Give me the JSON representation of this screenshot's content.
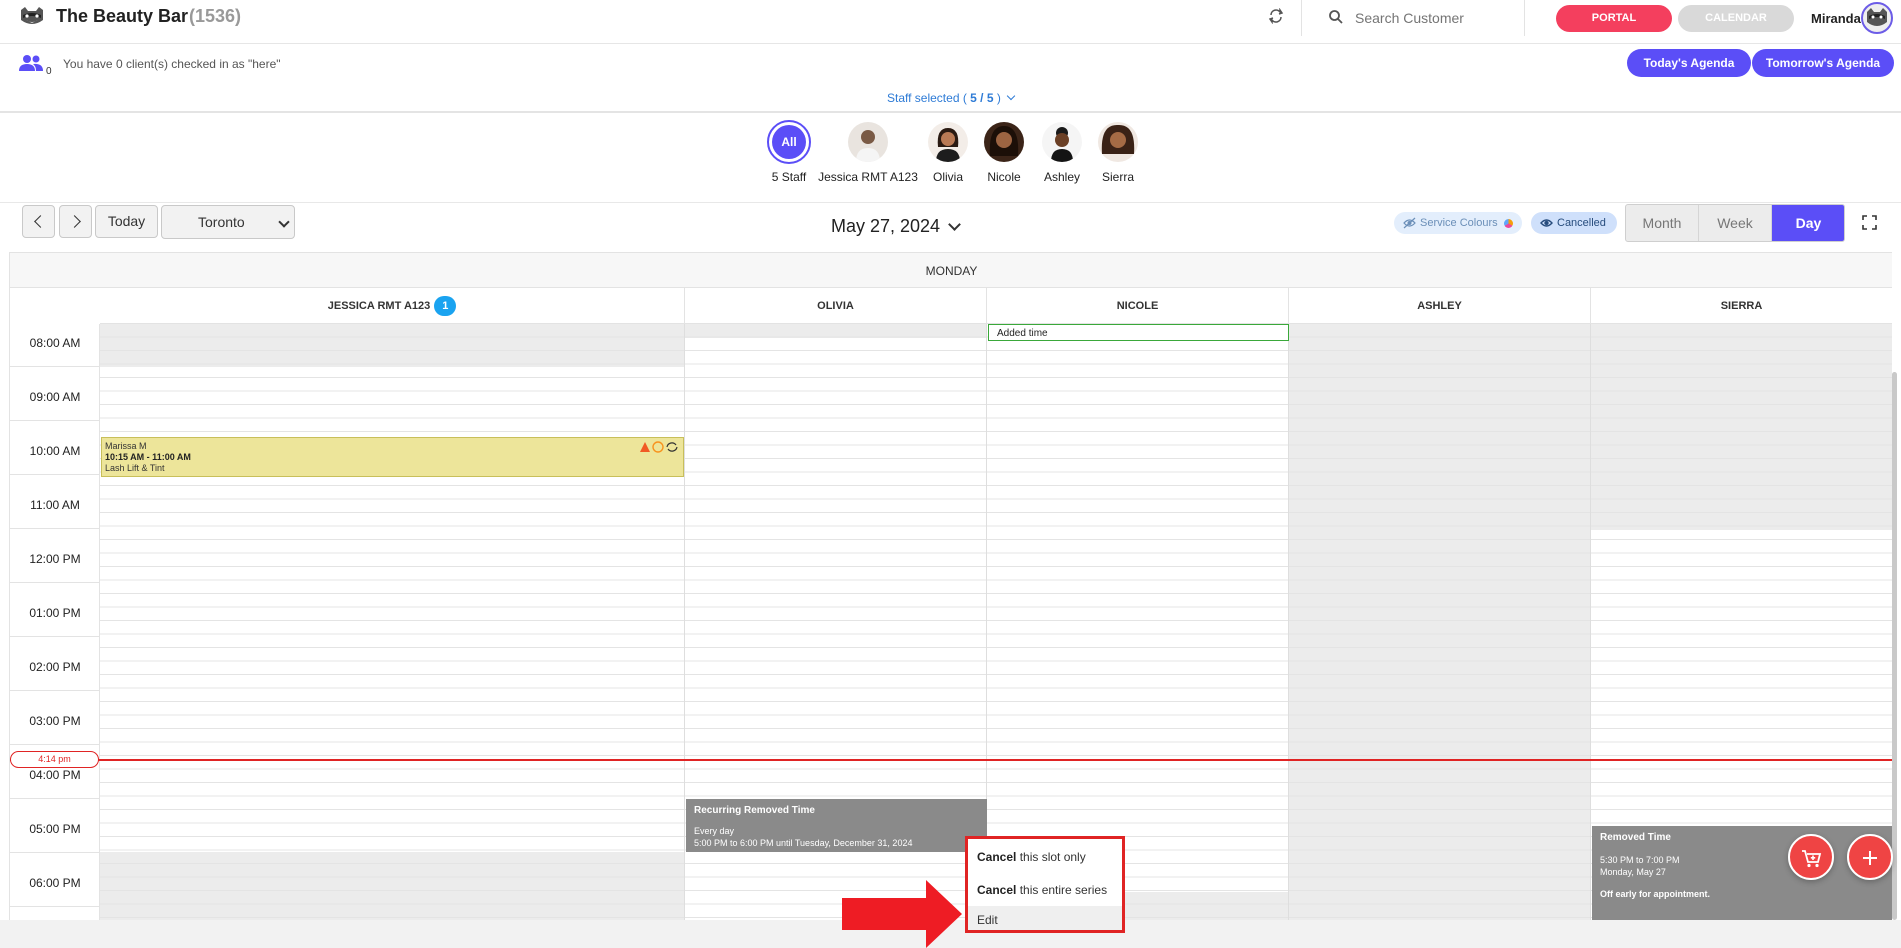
{
  "header": {
    "brand": "The Beauty Bar",
    "brand_count": "(1536)",
    "search_placeholder": "Search Customer",
    "portal_label": "PORTAL",
    "calendar_label": "CALENDAR",
    "user_name": "Miranda"
  },
  "checkin": {
    "count": "0",
    "text": "You have 0 client(s) checked in as \"here\""
  },
  "agenda": {
    "today": "Today's Agenda",
    "tomorrow": "Tomorrow's Agenda"
  },
  "staff_selected": {
    "prefix": "Staff selected (",
    "value": "5 / 5",
    "suffix": ")"
  },
  "staff": [
    {
      "label": "5 Staff",
      "avatar_text": "All"
    },
    {
      "label": "Jessica RMT A123"
    },
    {
      "label": "Olivia"
    },
    {
      "label": "Nicole"
    },
    {
      "label": "Ashley"
    },
    {
      "label": "Sierra"
    }
  ],
  "toolbar": {
    "today": "Today",
    "timezone": "Toronto",
    "date": "May 27, 2024",
    "service_colours": "Service Colours",
    "cancelled": "Cancelled",
    "views": [
      "Month",
      "Week",
      "Day"
    ],
    "active_view": "Day"
  },
  "calendar": {
    "day_name": "MONDAY",
    "columns": [
      {
        "name": "JESSICA RMT A123",
        "badge": "1"
      },
      {
        "name": "OLIVIA"
      },
      {
        "name": "NICOLE"
      },
      {
        "name": "ASHLEY"
      },
      {
        "name": "SIERRA"
      }
    ],
    "times": [
      "08:00 AM",
      "09:00 AM",
      "10:00 AM",
      "11:00 AM",
      "12:00 PM",
      "01:00 PM",
      "02:00 PM",
      "03:00 PM",
      "04:00 PM",
      "05:00 PM",
      "06:00 PM"
    ],
    "now_label": "4:14 pm",
    "appointment": {
      "client": "Marissa M",
      "time": "10:15 AM - 11:00 AM",
      "service": "Lash Lift & Tint"
    },
    "added_time": "Added time",
    "olivia_removed": {
      "title": "Recurring Removed Time",
      "line1": "Every day",
      "line2": "5:00 PM to 6:00 PM until Tuesday, December 31, 2024"
    },
    "sierra_removed": {
      "title": "Removed Time",
      "line1": "5:30 PM to 7:00 PM",
      "line2": "Monday, May 27",
      "line3": "Off early for appointment."
    }
  },
  "context_menu": {
    "item1_bold": "Cancel",
    "item1_rest": " this slot only",
    "item2_bold": "Cancel",
    "item2_rest": " this entire series",
    "item3": "Edit"
  },
  "colors": {
    "accent": "#5b4ef7",
    "portal": "#f43f5e",
    "now_line": "#e02424"
  }
}
